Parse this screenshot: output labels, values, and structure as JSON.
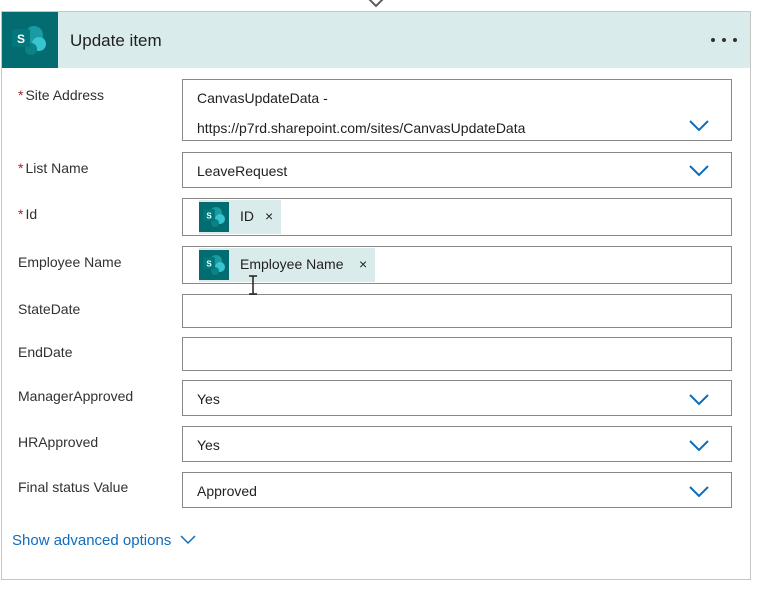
{
  "action": {
    "title": "Update item",
    "connector_icon": "sharepoint-icon",
    "more_label": "..."
  },
  "colors": {
    "header_bg": "#d9eceb",
    "brand": "#036c70",
    "required": "#a4262c",
    "link": "#0f6cbd"
  },
  "required_marker": "*",
  "fields": {
    "site_address": {
      "label": "Site Address",
      "required": true,
      "value_line1": "CanvasUpdateData -",
      "value_line2": "https://p7rd.sharepoint.com/sites/CanvasUpdateData",
      "control": "dropdown"
    },
    "list_name": {
      "label": "List Name",
      "required": true,
      "value": "LeaveRequest",
      "control": "dropdown"
    },
    "id": {
      "label": "Id",
      "required": true,
      "token": "ID",
      "token_remove": "×",
      "control": "token-input"
    },
    "employee_name": {
      "label": "Employee Name",
      "required": false,
      "token": "Employee Name",
      "token_remove": "×",
      "control": "token-input"
    },
    "state_date": {
      "label": "StateDate",
      "required": false,
      "value": "",
      "control": "text"
    },
    "end_date": {
      "label": "EndDate",
      "required": false,
      "value": "",
      "control": "text"
    },
    "manager_approved": {
      "label": "ManagerApproved",
      "required": false,
      "value": "Yes",
      "control": "dropdown"
    },
    "hr_approved": {
      "label": "HRApproved",
      "required": false,
      "value": "Yes",
      "control": "dropdown"
    },
    "final_status": {
      "label": "Final status Value",
      "required": false,
      "value": "Approved",
      "control": "dropdown"
    }
  },
  "advanced_options_label": "Show advanced options"
}
